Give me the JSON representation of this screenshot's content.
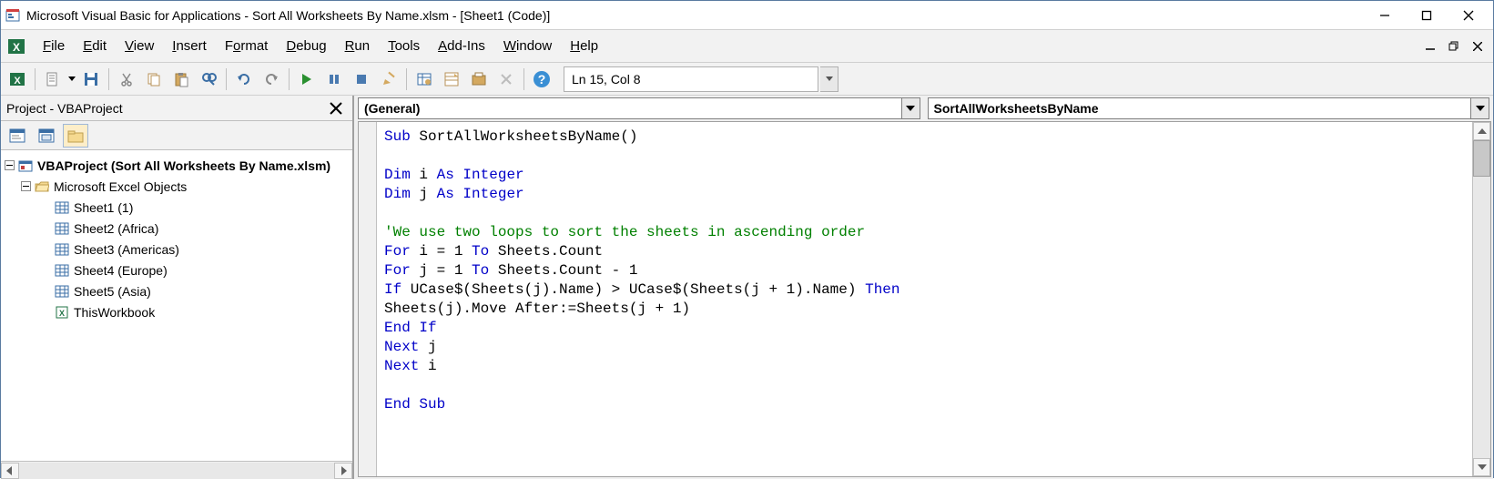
{
  "window": {
    "title": "Microsoft Visual Basic for Applications - Sort All Worksheets By Name.xlsm - [Sheet1 (Code)]"
  },
  "menu": {
    "file": "File",
    "edit": "Edit",
    "view": "View",
    "insert": "Insert",
    "format": "Format",
    "debug": "Debug",
    "run": "Run",
    "tools": "Tools",
    "addins": "Add-Ins",
    "window": "Window",
    "help": "Help"
  },
  "toolbar": {
    "cursor_pos": "Ln 15, Col 8"
  },
  "project_pane": {
    "title": "Project - VBAProject",
    "root": "VBAProject (Sort All Worksheets By Name.xlsm)",
    "folder": "Microsoft Excel Objects",
    "items": [
      "Sheet1 (1)",
      "Sheet2 (Africa)",
      "Sheet3 (Americas)",
      "Sheet4 (Europe)",
      "Sheet5 (Asia)",
      "ThisWorkbook"
    ]
  },
  "combos": {
    "left": "(General)",
    "right": "SortAllWorksheetsByName"
  },
  "code": {
    "l1a": "Sub",
    "l1b": " SortAllWorksheetsByName()",
    "l3a": "Dim",
    "l3b": " i ",
    "l3c": "As Integer",
    "l4a": "Dim",
    "l4b": " j ",
    "l4c": "As Integer",
    "l6": "'We use two loops to sort the sheets in ascending order",
    "l7a": "For",
    "l7b": " i = 1 ",
    "l7c": "To",
    "l7d": " Sheets.Count",
    "l8a": "For",
    "l8b": " j = 1 ",
    "l8c": "To",
    "l8d": " Sheets.Count - 1",
    "l9a": "If",
    "l9b": " UCase$(Sheets(j).Name) > UCase$(Sheets(j + 1).Name) ",
    "l9c": "Then",
    "l10": "Sheets(j).Move After:=Sheets(j + 1)",
    "l11": "End If",
    "l12a": "Next",
    "l12b": " j",
    "l13a": "Next",
    "l13b": " i",
    "l15": "End Sub"
  }
}
